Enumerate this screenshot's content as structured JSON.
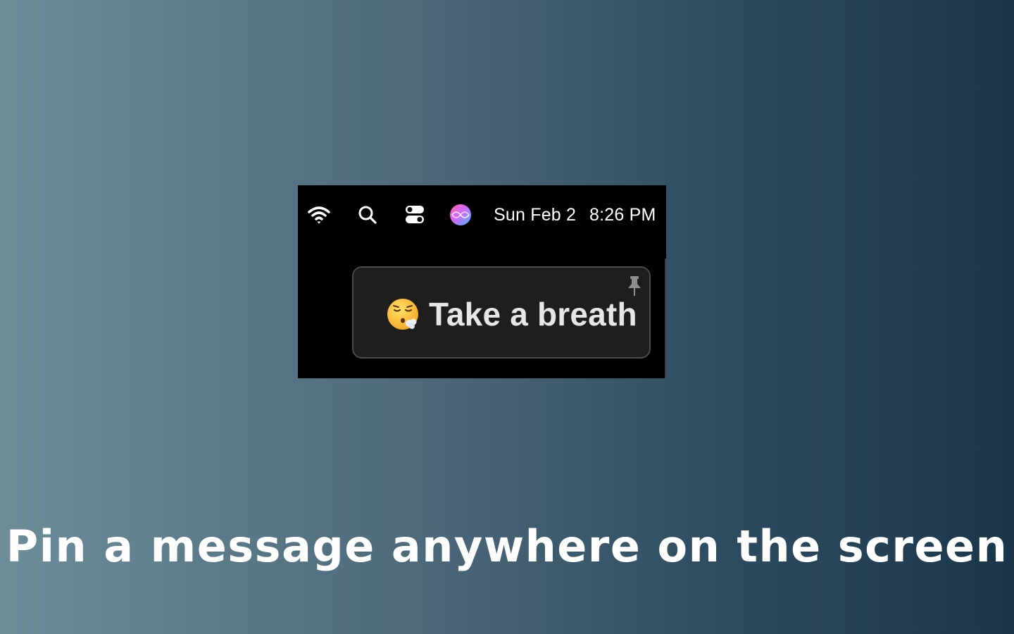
{
  "menubar": {
    "wifi_icon": "wifi-icon",
    "search_icon": "search-icon",
    "control_center_icon": "control-center-icon",
    "siri_icon": "siri-icon",
    "date": "Sun Feb 2",
    "time": "8:26 PM"
  },
  "pinned_message": {
    "emoji": "😮‍💨",
    "text": "Take a breath",
    "pin_icon": "pin-icon"
  },
  "caption": "Pin a message anywhere on the screen",
  "colors": {
    "background_start": "#6d8d99",
    "background_end": "#1a364b",
    "menubar_bg": "#000000",
    "card_bg": "#1e1e1e",
    "card_text": "#e6e6e6"
  }
}
